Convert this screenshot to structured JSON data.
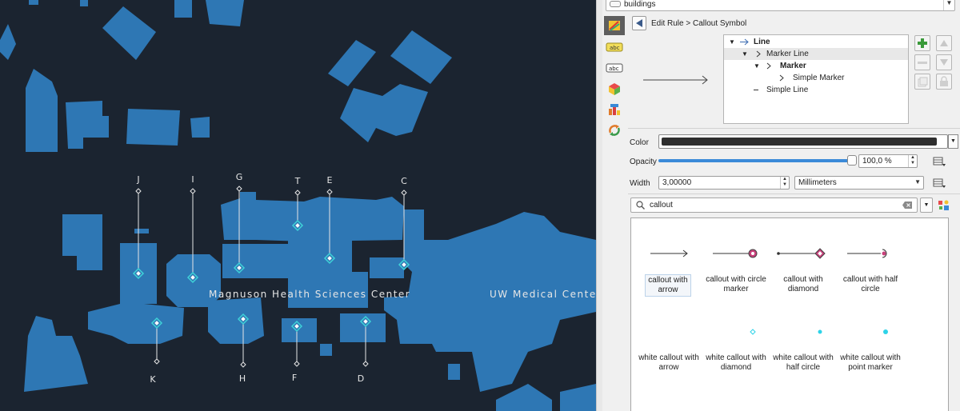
{
  "map": {
    "label_magnuson": "Magnuson Health Sciences Center",
    "label_uwmc": "UW Medical Center",
    "callouts_top": [
      "J",
      "I",
      "G",
      "T",
      "E",
      "C"
    ],
    "callouts_bottom": [
      "K",
      "H",
      "F",
      "D"
    ],
    "colors": {
      "background": "#1b2430",
      "building": "#2e77b4",
      "marker": "#3fd2d8",
      "line": "#e6e6e6"
    }
  },
  "panel": {
    "layer_combo": {
      "value": "buildings"
    },
    "side_tabs": [
      "symbology-icon",
      "labels-icon",
      "abc-labels-icon",
      "3d-view-icon",
      "diagrams-icon",
      "rendering-icon"
    ],
    "breadcrumb": "Edit Rule > Callout Symbol",
    "tree": {
      "line": "Line",
      "marker_line": "Marker Line",
      "marker": "Marker",
      "simple_marker": "Simple Marker",
      "simple_line": "Simple Line"
    },
    "props": {
      "color_label": "Color",
      "color_value": "#2e2e2e",
      "opacity_label": "Opacity",
      "opacity_value": "100,0 %",
      "opacity_fraction": 1.0,
      "width_label": "Width",
      "width_value": "3,00000",
      "unit_value": "Millimeters"
    },
    "search": {
      "value": "callout"
    },
    "library": [
      {
        "label": "callout with arrow",
        "style": "arrow",
        "selected": true
      },
      {
        "label": "callout with circle marker",
        "style": "circle"
      },
      {
        "label": "callout with diamond",
        "style": "diamond"
      },
      {
        "label": "callout with half circle",
        "style": "halfcircle"
      },
      {
        "label": "white callout with arrow",
        "style": "none"
      },
      {
        "label": "white callout with diamond",
        "style": "white-diamond"
      },
      {
        "label": "white callout with half circle",
        "style": "white-dot"
      },
      {
        "label": "white callout with point marker",
        "style": "white-point"
      }
    ]
  }
}
